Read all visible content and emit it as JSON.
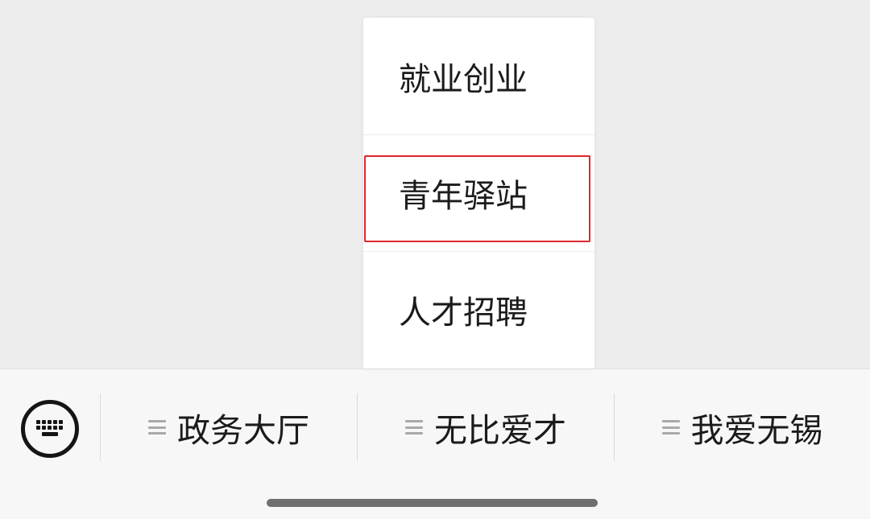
{
  "submenu": {
    "items": [
      {
        "label": "就业创业",
        "highlighted": false
      },
      {
        "label": "青年驿站",
        "highlighted": true
      },
      {
        "label": "人才招聘",
        "highlighted": false
      }
    ],
    "highlight_color": "#e0262b"
  },
  "menubar": {
    "keyboard_icon": "keyboard-icon",
    "tabs": [
      {
        "label": "政务大厅",
        "icon": "menu-lines-icon"
      },
      {
        "label": "无比爱才",
        "icon": "menu-lines-icon"
      },
      {
        "label": "我爱无锡",
        "icon": "menu-lines-icon"
      }
    ]
  }
}
